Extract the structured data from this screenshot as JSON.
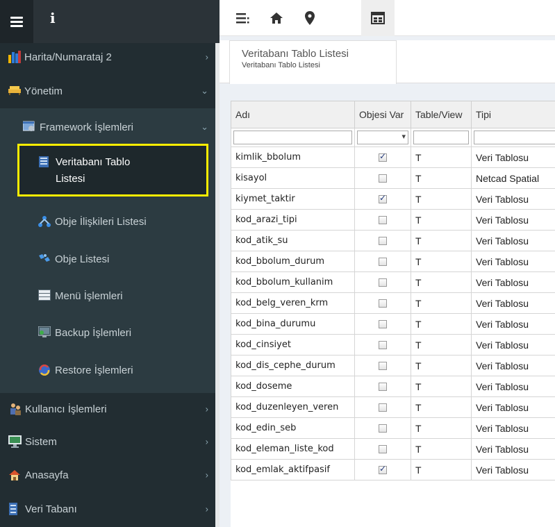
{
  "header": {
    "info_glyph": "i",
    "toolbar_icons": [
      "list-menu-icon",
      "home-icon",
      "map-pin-icon",
      "window-icon"
    ]
  },
  "sidebar": {
    "items": [
      {
        "label": "Harita/Numarataj 2",
        "icon": "chart-icon",
        "chevron": "›"
      },
      {
        "label": "Yönetim",
        "icon": "sofa-icon",
        "chevron": "⌄"
      },
      {
        "label": "Framework İşlemleri",
        "icon": "framework-icon",
        "chevron": "⌄"
      },
      {
        "label": "Veritabanı Tablo Listesi",
        "icon": "database-table-icon"
      },
      {
        "label": "Obje İlişkileri Listesi",
        "icon": "hierarchy-icon"
      },
      {
        "label": "Obje Listesi",
        "icon": "objects-icon"
      },
      {
        "label": "Menü İşlemleri",
        "icon": "menu-list-icon"
      },
      {
        "label": "Backup İşlemleri",
        "icon": "backup-icon"
      },
      {
        "label": "Restore İşlemleri",
        "icon": "restore-icon"
      },
      {
        "label": "Kullanıcı İşlemleri",
        "icon": "users-icon",
        "chevron": "›"
      },
      {
        "label": "Sistem",
        "icon": "monitor-icon",
        "chevron": "›"
      },
      {
        "label": "Anasayfa",
        "icon": "home-icon",
        "chevron": "›"
      },
      {
        "label": "Veri Tabanı",
        "icon": "database-icon",
        "chevron": "›"
      }
    ]
  },
  "tab": {
    "title": "Veritabanı Tablo Listesi",
    "subtitle": "Veritabanı Tablo Listesi"
  },
  "table": {
    "columns": [
      "Adı",
      "Objesi Var",
      "Table/View",
      "Tipi"
    ],
    "rows": [
      {
        "adi": "kimlik_bbolum",
        "objesi": true,
        "tv": "T",
        "tipi": "Veri Tablosu"
      },
      {
        "adi": "kisayol",
        "objesi": false,
        "tv": "T",
        "tipi": "Netcad Spatial"
      },
      {
        "adi": "kiymet_taktir",
        "objesi": true,
        "tv": "T",
        "tipi": "Veri Tablosu"
      },
      {
        "adi": "kod_arazi_tipi",
        "objesi": false,
        "tv": "T",
        "tipi": "Veri Tablosu"
      },
      {
        "adi": "kod_atik_su",
        "objesi": false,
        "tv": "T",
        "tipi": "Veri Tablosu"
      },
      {
        "adi": "kod_bbolum_durum",
        "objesi": false,
        "tv": "T",
        "tipi": "Veri Tablosu"
      },
      {
        "adi": "kod_bbolum_kullanim",
        "objesi": false,
        "tv": "T",
        "tipi": "Veri Tablosu"
      },
      {
        "adi": "kod_belg_veren_krm",
        "objesi": false,
        "tv": "T",
        "tipi": "Veri Tablosu"
      },
      {
        "adi": "kod_bina_durumu",
        "objesi": false,
        "tv": "T",
        "tipi": "Veri Tablosu"
      },
      {
        "adi": "kod_cinsiyet",
        "objesi": false,
        "tv": "T",
        "tipi": "Veri Tablosu"
      },
      {
        "adi": "kod_dis_cephe_durum",
        "objesi": false,
        "tv": "T",
        "tipi": "Veri Tablosu"
      },
      {
        "adi": "kod_doseme",
        "objesi": false,
        "tv": "T",
        "tipi": "Veri Tablosu"
      },
      {
        "adi": "kod_duzenleyen_veren",
        "objesi": false,
        "tv": "T",
        "tipi": "Veri Tablosu"
      },
      {
        "adi": "kod_edin_seb",
        "objesi": false,
        "tv": "T",
        "tipi": "Veri Tablosu"
      },
      {
        "adi": "kod_eleman_liste_kod",
        "objesi": false,
        "tv": "T",
        "tipi": "Veri Tablosu"
      },
      {
        "adi": "kod_emlak_aktifpasif",
        "objesi": true,
        "tv": "T",
        "tipi": "Veri Tablosu"
      }
    ]
  },
  "colors": {
    "sidebar_bg": "#222d32",
    "sidebar_sub_bg": "#2c3b41",
    "highlight_border": "#ffed00"
  }
}
